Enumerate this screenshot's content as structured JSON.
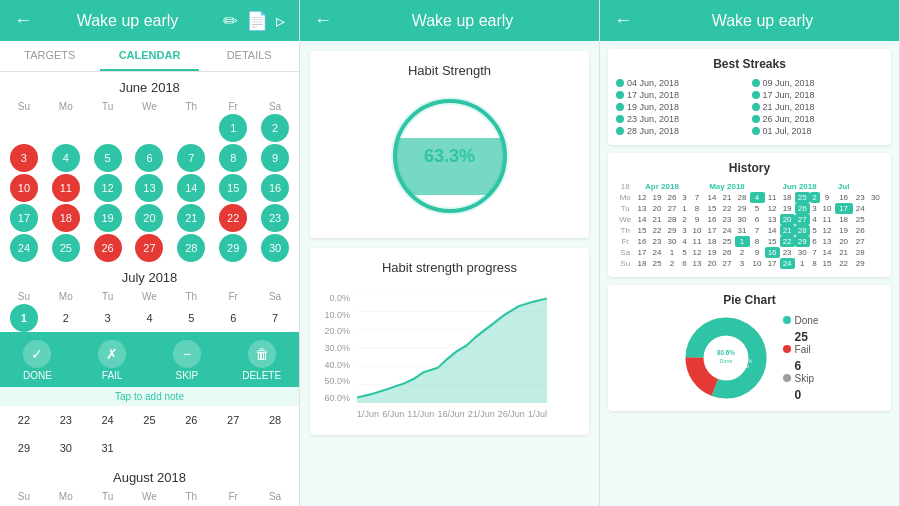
{
  "panel1": {
    "title": "Wake up early",
    "tabs": [
      "TARGETS",
      "CALENDAR",
      "DETAILS"
    ],
    "activeTab": 1,
    "months": [
      {
        "name": "June 2018",
        "dows": [
          "Su",
          "Mo",
          "Tu",
          "We",
          "Th",
          "Fr",
          "Sa"
        ],
        "days": [
          {
            "d": "",
            "state": ""
          },
          {
            "d": "",
            "state": ""
          },
          {
            "d": "",
            "state": ""
          },
          {
            "d": "",
            "state": ""
          },
          {
            "d": "",
            "state": ""
          },
          {
            "d": "1",
            "state": "done"
          },
          {
            "d": "2",
            "state": "done"
          },
          {
            "d": "3",
            "state": "fail"
          },
          {
            "d": "4",
            "state": "done"
          },
          {
            "d": "5",
            "state": "done"
          },
          {
            "d": "6",
            "state": "done"
          },
          {
            "d": "7",
            "state": "done"
          },
          {
            "d": "8",
            "state": "done"
          },
          {
            "d": "9",
            "state": "done"
          },
          {
            "d": "10",
            "state": "fail"
          },
          {
            "d": "11",
            "state": "fail"
          },
          {
            "d": "12",
            "state": "done"
          },
          {
            "d": "13",
            "state": "done"
          },
          {
            "d": "14",
            "state": "done"
          },
          {
            "d": "15",
            "state": "done"
          },
          {
            "d": "16",
            "state": "done"
          },
          {
            "d": "17",
            "state": "done"
          },
          {
            "d": "18",
            "state": "fail"
          },
          {
            "d": "19",
            "state": "done"
          },
          {
            "d": "20",
            "state": "done"
          },
          {
            "d": "21",
            "state": "done"
          },
          {
            "d": "22",
            "state": "fail"
          },
          {
            "d": "23",
            "state": "done"
          },
          {
            "d": "24",
            "state": "done"
          },
          {
            "d": "25",
            "state": "done"
          },
          {
            "d": "26",
            "state": "fail"
          },
          {
            "d": "27",
            "state": "fail"
          },
          {
            "d": "28",
            "state": "done"
          },
          {
            "d": "29",
            "state": "done"
          },
          {
            "d": "30",
            "state": "done"
          }
        ]
      },
      {
        "name": "July 2018",
        "dows": [
          "Su",
          "Mo",
          "Tu",
          "We",
          "Th",
          "Fr",
          "Sa"
        ],
        "days": [
          {
            "d": "1",
            "state": "today"
          },
          {
            "d": "2",
            "state": ""
          },
          {
            "d": "3",
            "state": ""
          },
          {
            "d": "4",
            "state": ""
          },
          {
            "d": "5",
            "state": ""
          },
          {
            "d": "6",
            "state": ""
          },
          {
            "d": "7",
            "state": ""
          }
        ]
      }
    ],
    "actionBar": [
      {
        "label": "DONE",
        "icon": "✓"
      },
      {
        "label": "FAIL",
        "icon": "✗"
      },
      {
        "label": "SKIP",
        "icon": "−"
      },
      {
        "label": "DELETE",
        "icon": "🗑"
      }
    ],
    "tapNote": "Tap to add note",
    "month3": {
      "name": "August 2018",
      "dows": [
        "Su",
        "Mo",
        "Tu",
        "We",
        "Th",
        "Fr",
        "Sa"
      ]
    },
    "extraRows": [
      [
        "22",
        "23",
        "24",
        "25",
        "26",
        "27",
        "28"
      ],
      [
        "29",
        "30",
        "31",
        "",
        "",
        "",
        ""
      ]
    ]
  },
  "panel2": {
    "title": "Wake up early",
    "habitStrength": {
      "title": "Habit Strength",
      "value": "63.3%",
      "percent": 63.3
    },
    "progressChart": {
      "title": "Habit strength progress",
      "xLabels": [
        "1/Jun",
        "6/Jun",
        "11/Jun",
        "16/Jun",
        "21/Jun",
        "26/Jun",
        "1/Jul"
      ],
      "yLabels": [
        "0.0%",
        "10.0%",
        "20.0%",
        "30.0%",
        "40.0%",
        "50.0%",
        "60.0%"
      ]
    }
  },
  "panel3": {
    "title": "Wake up early",
    "bestStreaks": {
      "title": "Best Streaks",
      "col1": [
        "04 Jun, 2018",
        "17 Jun, 2018",
        "19 Jun, 2018",
        "23 Jun, 2018",
        "28 Jun, 2018"
      ],
      "col2": [
        "09 Jun, 2018",
        "17 Jun, 2018",
        "21 Jun, 2018",
        "26 Jun, 2018",
        "01 Jul, 2018"
      ]
    },
    "history": {
      "title": "History",
      "monthHeaders": [
        "18",
        "Apr 2018",
        "",
        "May 2018",
        "",
        "Jun 2018",
        "Jul"
      ],
      "dows": [
        "Mo",
        "Tu",
        "We",
        "Th",
        "Fr",
        "Sa",
        "Su"
      ]
    },
    "pieChart": {
      "title": "Pie Chart",
      "segments": [
        {
          "label": "Done",
          "value": 25,
          "color": "#2ec4a5",
          "percent": 80.6
        },
        {
          "label": "Fail",
          "value": 6,
          "color": "#e53935",
          "percent": 19.4
        },
        {
          "label": "Skip",
          "value": 0,
          "color": "#9e9e9e",
          "percent": 0
        }
      ],
      "centerLabel": "80.6%\nDone"
    }
  }
}
